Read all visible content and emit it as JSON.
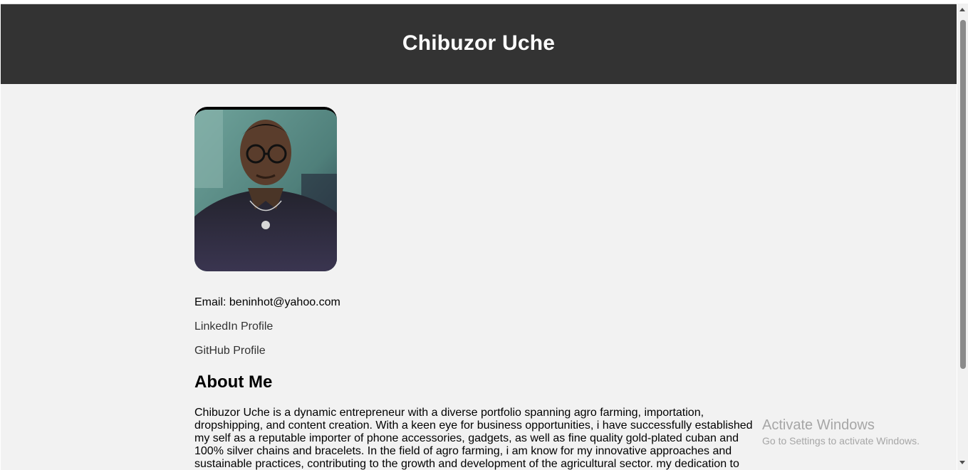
{
  "header": {
    "title": "Chibuzor Uche"
  },
  "profile": {
    "photo_alt": "Profile photo",
    "email_text": "Email: beninhot@yahoo.com",
    "linkedin_label": "LinkedIn Profile",
    "github_label": "GitHub Profile"
  },
  "about": {
    "heading": "About Me",
    "text": "Chibuzor Uche is a dynamic entrepreneur with a diverse portfolio spanning agro farming, importation, dropshipping, and content creation. With a keen eye for business opportunities, i have successfully established my self as a reputable importer of phone accessories, gadgets, as well as fine quality gold-plated cuban and 100% silver chains and bracelets. In the field of agro farming, i am know for my innovative approaches and sustainable practices, contributing to the growth and development of the agricultural sector. my dedication to"
  },
  "watermark": {
    "title": "Activate Windows",
    "subtitle": "Go to Settings to activate Windows."
  },
  "colors": {
    "header_bg": "#333333",
    "page_bg": "#f2f2f2",
    "link": "#333333"
  }
}
